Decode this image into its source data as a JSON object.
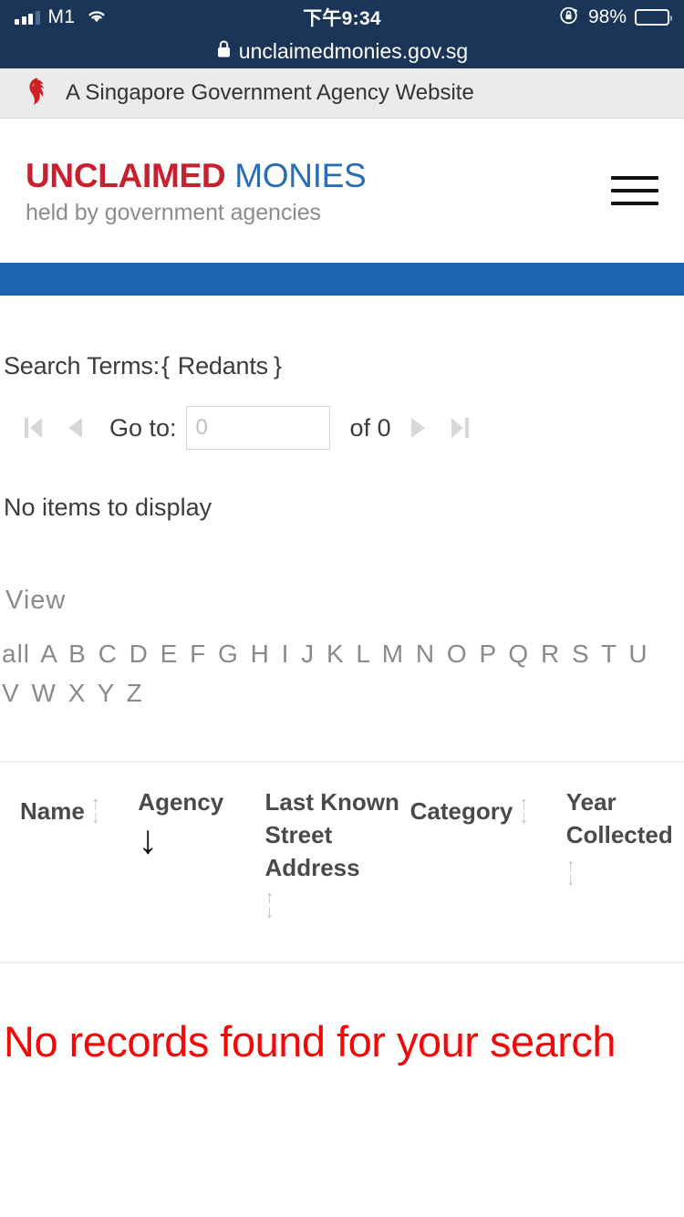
{
  "statusbar": {
    "carrier": "M1",
    "signal_icon": "signal-bars-icon",
    "wifi_icon": "wifi-icon",
    "time": "下午9:34",
    "rotation_lock_icon": "rotation-lock-icon",
    "battery_percent": "98%",
    "battery_icon": "battery-icon",
    "background_color": "#1b3558"
  },
  "urlbar": {
    "lock_icon": "lock-icon",
    "url": "unclaimedmonies.gov.sg"
  },
  "gov_banner": {
    "lion_icon": "singapore-lion-head-icon",
    "text": "A Singapore Government Agency Website",
    "background_color": "#ebebeb"
  },
  "site_header": {
    "logo_primary": "UNCLAIMED",
    "logo_secondary": "MONIES",
    "tagline": "held by government agencies",
    "logo_primary_color": "#c8202f",
    "logo_secondary_color": "#2a6db5",
    "menu_icon": "hamburger-menu-icon"
  },
  "blue_bar": {
    "color": "#1e63ad"
  },
  "search": {
    "label": "Search Terms:",
    "open_brace": "{",
    "term": "Redants",
    "close_brace": "}"
  },
  "pager": {
    "first_icon": "first-page-icon",
    "prev_icon": "previous-page-icon",
    "goto_label": "Go to:",
    "page_value": "",
    "page_placeholder": "0",
    "total_label": "of 0",
    "next_icon": "next-page-icon",
    "last_icon": "last-page-icon"
  },
  "empty_state": {
    "text": "No items to display"
  },
  "view_nav": {
    "label": "View",
    "links": [
      "all",
      "A",
      "B",
      "C",
      "D",
      "E",
      "F",
      "G",
      "H",
      "I",
      "J",
      "K",
      "L",
      "M",
      "N",
      "O",
      "P",
      "Q",
      "R",
      "S",
      "T",
      "U",
      "V",
      "W",
      "X",
      "Y",
      "Z"
    ]
  },
  "table": {
    "columns": [
      {
        "label": "Name",
        "sort": "none",
        "sort_icon": "sort-both-icon"
      },
      {
        "label": "Agency",
        "sort": "desc",
        "sort_icon": "sort-desc-arrow-icon"
      },
      {
        "label": "Last Known Street Address",
        "sort": "none",
        "sort_icon": "sort-both-icon"
      },
      {
        "label": "Category",
        "sort": "none",
        "sort_icon": "sort-both-icon"
      },
      {
        "label": "Year Collected",
        "sort": "none",
        "sort_icon": "sort-both-icon"
      }
    ],
    "rows": []
  },
  "result_message": {
    "text": "No records found for your search",
    "color": "#f30808"
  }
}
